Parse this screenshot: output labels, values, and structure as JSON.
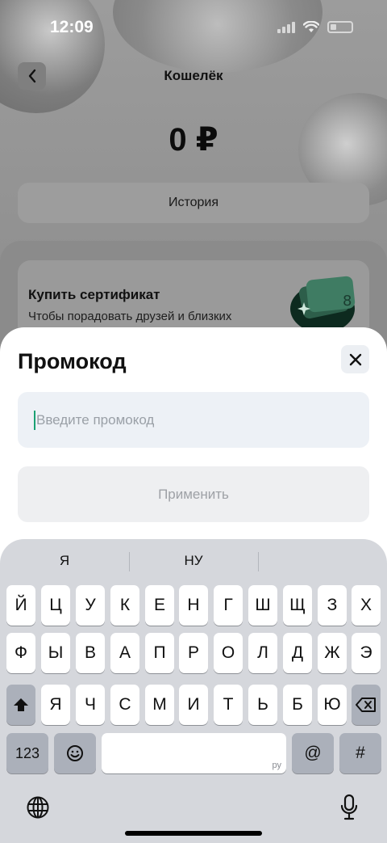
{
  "status_bar": {
    "time": "12:09"
  },
  "wallet": {
    "title": "Кошелёк",
    "balance": "0 ₽",
    "history_label": "История",
    "certificate_title": "Купить сертификат",
    "certificate_subtitle": "Чтобы порадовать друзей и близких"
  },
  "sheet": {
    "title": "Промокод",
    "input_placeholder": "Введите промокод",
    "input_value": "",
    "apply_label": "Применить"
  },
  "keyboard": {
    "suggestions": [
      "Я",
      "НУ",
      ""
    ],
    "rows": [
      [
        "Й",
        "Ц",
        "У",
        "К",
        "Е",
        "Н",
        "Г",
        "Ш",
        "Щ",
        "З",
        "Х"
      ],
      [
        "Ф",
        "Ы",
        "В",
        "А",
        "П",
        "Р",
        "О",
        "Л",
        "Д",
        "Ж",
        "Э"
      ],
      [
        "Я",
        "Ч",
        "С",
        "М",
        "И",
        "Т",
        "Ь",
        "Б",
        "Ю"
      ]
    ],
    "numbers_label": "123",
    "space_lang": "ру",
    "at_label": "@",
    "hash_label": "#"
  },
  "colors": {
    "accent_caret": "#1aa173",
    "sheet_background": "#ffffff",
    "input_background": "#edf1f6",
    "keyboard_background": "#d5d7dc"
  }
}
